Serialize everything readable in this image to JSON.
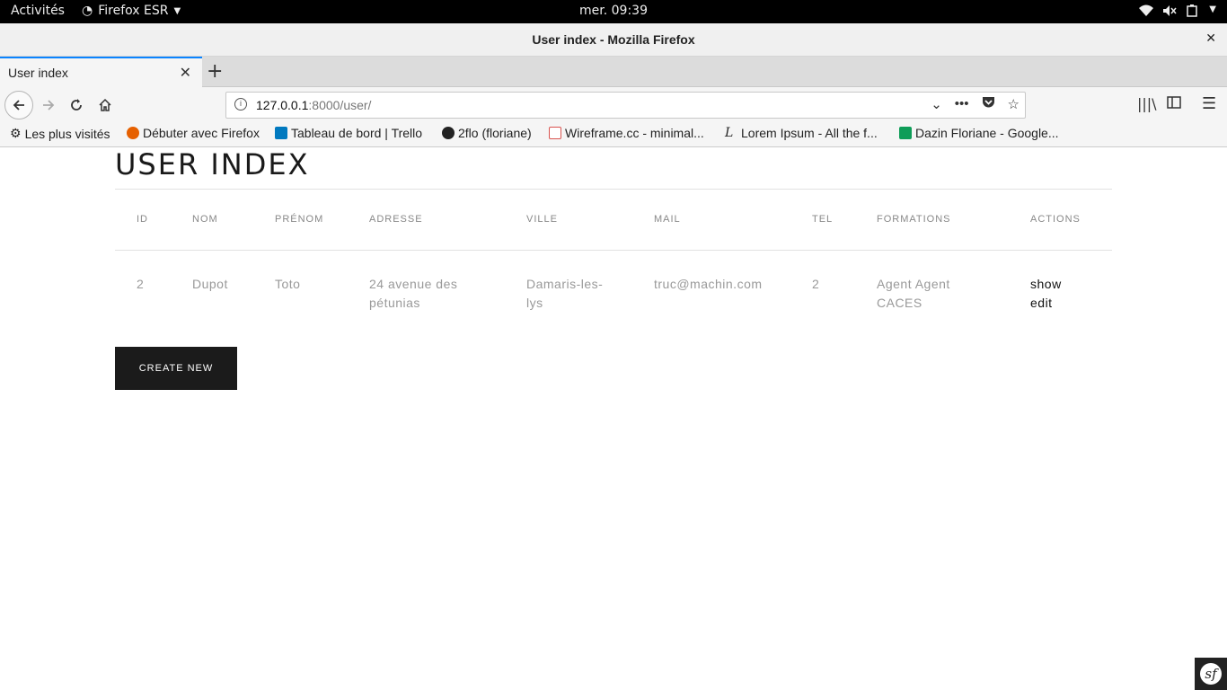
{
  "system": {
    "activities": "Activités",
    "app_name": "Firefox ESR",
    "clock": "mer. 09:39"
  },
  "window": {
    "title": "User index - Mozilla Firefox"
  },
  "tab": {
    "label": "User index"
  },
  "urlbar": {
    "host": "127.0.0.1",
    "rest": ":8000/user/"
  },
  "bookmarks": [
    {
      "label": "Les plus visités",
      "icon": "gear-icon"
    },
    {
      "label": "Débuter avec Firefox",
      "icon": "firefox-icon"
    },
    {
      "label": "Tableau de bord | Trello",
      "icon": "trello-icon"
    },
    {
      "label": "2flo (floriane)",
      "icon": "github-icon"
    },
    {
      "label": "Wireframe.cc - minimal...",
      "icon": "wireframe-icon"
    },
    {
      "label": "Lorem Ipsum - All the f...",
      "icon": "lorem-icon"
    },
    {
      "label": "Dazin Floriane - Google...",
      "icon": "google-sheets-icon"
    }
  ],
  "page": {
    "heading": "USER INDEX",
    "columns": [
      "ID",
      "NOM",
      "PRÉNOM",
      "ADRESSE",
      "VILLE",
      "MAIL",
      "TEL",
      "FORMATIONS",
      "ACTIONS"
    ],
    "rows": [
      {
        "id": "2",
        "nom": "Dupot",
        "prenom": "Toto",
        "adresse_1": "24 avenue des",
        "adresse_2": "pétunias",
        "ville_1": "Damaris-les-",
        "ville_2": "lys",
        "mail": "truc@machin.com",
        "tel": "2",
        "formations_1": "Agent Agent",
        "formations_2": "CACES",
        "action_show": "show",
        "action_edit": "edit"
      }
    ],
    "create_button": "CREATE NEW"
  },
  "colors": {
    "accent": "#0a84ff",
    "button_bg": "#1b1b1b",
    "muted_text": "#999999"
  }
}
